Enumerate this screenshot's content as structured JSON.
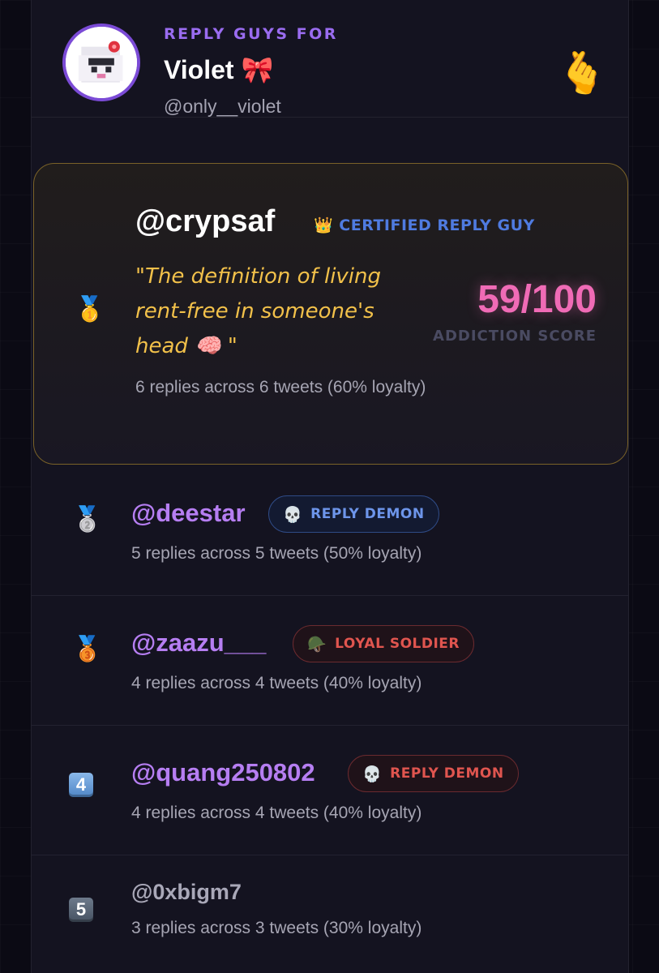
{
  "header": {
    "label": "REPLY GUYS FOR",
    "name": "Violet 🎀",
    "handle": "@only__violet",
    "emoji": "🫰"
  },
  "top": {
    "medal": "🥇",
    "username": "@crypsaf",
    "badge": "👑 CERTIFIED REPLY GUY",
    "quote": "\"The definition of living rent-free in someone's head 🧠 \"",
    "stats": "6 replies across 6 tweets (60% loyalty)",
    "score": "59/100",
    "score_label": "ADDICTION SCORE"
  },
  "rows": [
    {
      "rank": "🥈",
      "username": "@deestar",
      "badge_icon": "💀",
      "badge_label": "REPLY DEMON",
      "stats": "5 replies across 5 tweets (50% loyalty)"
    },
    {
      "rank": "🥉",
      "username": "@zaazu___",
      "badge_icon": "🪖",
      "badge_label": "LOYAL SOLDIER",
      "stats": "4 replies across 4 tweets (40% loyalty)"
    },
    {
      "rank": "4",
      "username": "@quang250802",
      "badge_icon": "💀",
      "badge_label": "REPLY DEMON",
      "stats": "4 replies across 4 tweets (40% loyalty)"
    },
    {
      "rank": "5",
      "username": "@0xbigm7",
      "stats": "3 replies across 3 tweets (30% loyalty)"
    }
  ],
  "colors": {
    "accent_purple": "#b67ef2",
    "gold": "#f2c14a",
    "score_pink": "#f06bb6",
    "badge_blue": "#6d95ea",
    "badge_red": "#e0554f"
  }
}
